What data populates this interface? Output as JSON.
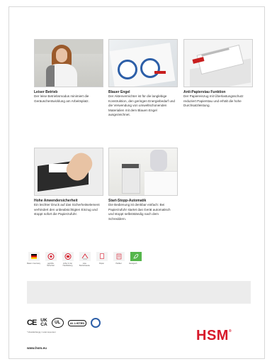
{
  "features": [
    {
      "title": "Leiser Betrieb",
      "desc": "Der leise Betriebsmodus minimiert die Geräuschentwicklung am Arbeitsplatz."
    },
    {
      "title": "Blauer Engel",
      "desc": "Der Aktenvernichter ist für die langlebige Konstruktion, den geringen Energiebedarf und die Verwendung von umweltschonenden Materialien mit dem Blauen Engel ausgezeichnet."
    },
    {
      "title": "Anti-Papierstau Funktion",
      "desc": "Der Papiereinzug mit Überlastungsschutz reduziert Papierstau und erhält die hohe Durchsatzleistung."
    },
    {
      "title": "Hohe Anwendersicherheit",
      "desc": "Ein leichter Druck auf das Sicherheitselement verhindert den unbeabsichtigten Einzug und stoppt sofort die Papierzufuhr."
    },
    {
      "title": "Start-Stopp-Automatik",
      "desc": "Die Bedienung ist denkbar einfach: Bei Papierzufuhr startet das Gerät automatisch und stoppt selbstständig nach dem Schreddern."
    }
  ],
  "icons": [
    {
      "name": "germany-flag-icon",
      "caption": "Made in Germany"
    },
    {
      "name": "safety-icon",
      "caption": "geprüfte Sicherheit"
    },
    {
      "name": "safety-icon-2",
      "caption": "sicher in der Handhabung"
    },
    {
      "name": "noise-icon",
      "caption": "leise Betriebsweise"
    },
    {
      "name": "paper-icon",
      "caption": "Papier"
    },
    {
      "name": "shred-icon",
      "caption": "Partikel"
    },
    {
      "name": "eco-icon",
      "caption": "ökologisch"
    }
  ],
  "certs": {
    "ce": "CE",
    "ukca_top": "UK",
    "ukca_bottom": "CA",
    "ul_listed": "UL LISTED",
    "footnote": "* Modellabhängig / model dependent"
  },
  "footer": {
    "url": "www.hsm.eu",
    "brand": "HSM",
    "reg": "®"
  },
  "colors": {
    "brand_red": "#d7182a",
    "eco_green": "#55b64b",
    "blue_angel": "#2d5fa8"
  }
}
